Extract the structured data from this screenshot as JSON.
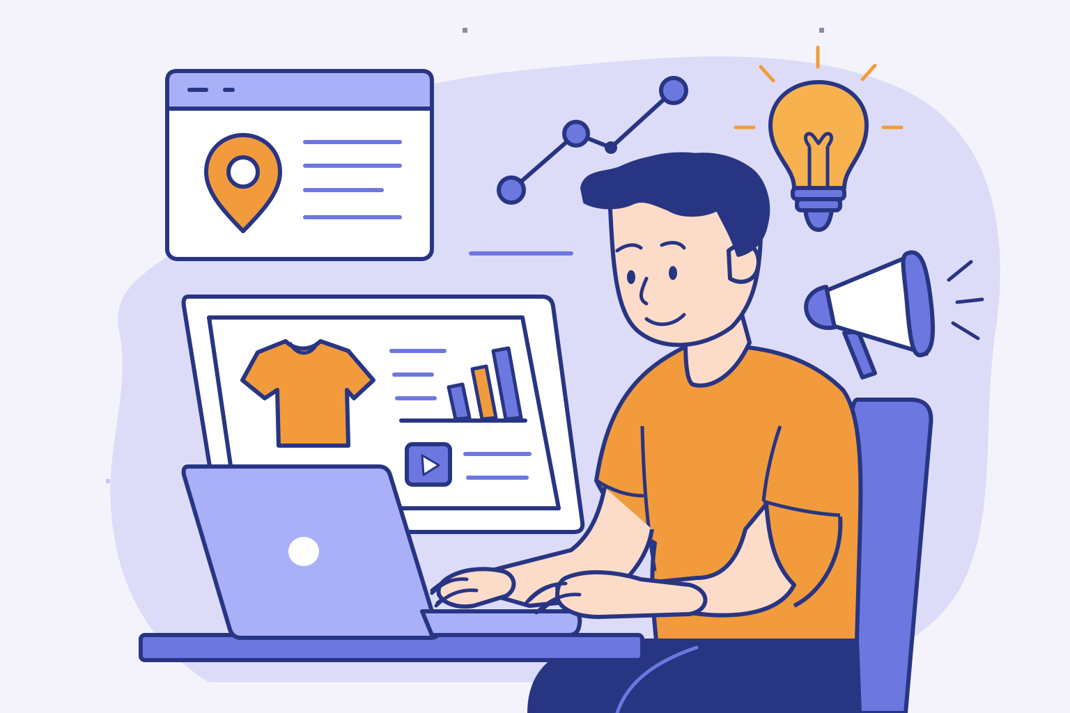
{
  "scene": {
    "description_icons": [
      "map-pin-icon",
      "t-shirt-icon",
      "bar-chart-icon",
      "play-icon",
      "line-graph-icon",
      "light-bulb-icon",
      "megaphone-icon",
      "laptop",
      "monitor",
      "browser-window",
      "person",
      "chair",
      "desk"
    ]
  },
  "colors": {
    "background": "#f4f3fb",
    "blob": "#dcdcf8",
    "outline": "#283583",
    "orange": "#f29b3c",
    "lavender": "#aab0f7",
    "periwinkle": "#6c77e0",
    "skin": "#fcdcc9",
    "hair": "#283583",
    "pants": "#283583",
    "white": "#ffffff",
    "bulb": "#f7b24f"
  }
}
